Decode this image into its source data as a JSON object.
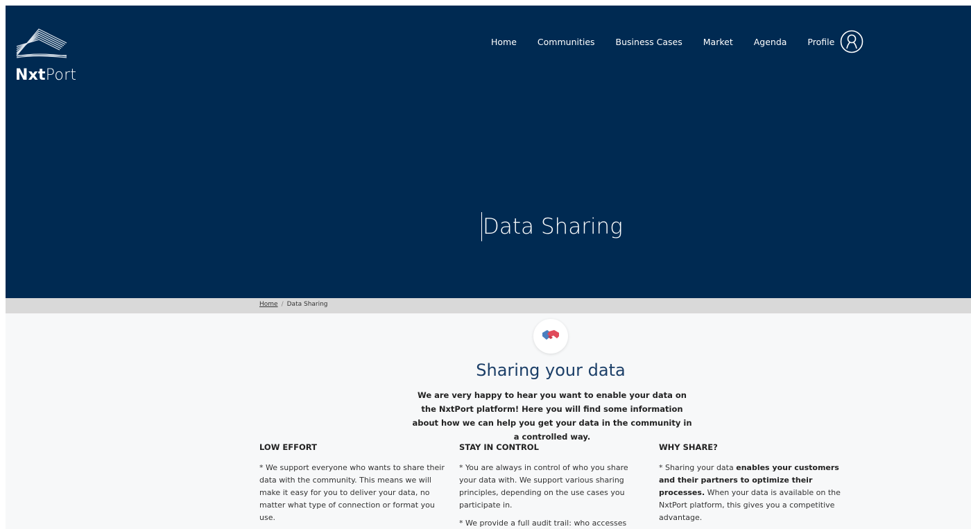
{
  "brand": {
    "logo_bold": "Nxt",
    "logo_light": "Port"
  },
  "nav": {
    "items": [
      "Home",
      "Communities",
      "Business Cases",
      "Market",
      "Agenda",
      "Profile"
    ],
    "profile_icon": "user-circle-icon"
  },
  "hero": {
    "title": "Data Sharing"
  },
  "breadcrumb": {
    "home": "Home",
    "separator": "/",
    "current": "Data Sharing"
  },
  "section": {
    "icon": "handshake-icon",
    "title": "Sharing your data",
    "intro": "We are very happy to hear you want to enable your data on the NxtPort platform! Here you will find some information about how we can help you get your data in the community in a controlled way."
  },
  "columns": {
    "low_effort": {
      "heading": "LOW EFFORT",
      "p1": "* We support everyone who wants to share their data with the community. This means we will make it easy for you to deliver your data, no matter what type of connection or format you use."
    },
    "stay_in_control": {
      "heading": "STAY IN CONTROL",
      "p1": "* You are always in control of who you share your data with. We support various sharing principles, depending on the use cases you participate in.",
      "p2": "* We provide a full audit trail: who accesses"
    },
    "why_share": {
      "heading": "WHY SHARE?",
      "p1_pre": "* Sharing your data ",
      "p1_bold": "enables your customers and their partners to optimize their processes.",
      "p1_post": " When your data is available on the NxtPort platform, this gives you a competitive advantage."
    }
  },
  "colors": {
    "hero_bg": "#002a52",
    "breadcrumb_bg": "#d9d9d9",
    "title_color": "#1c3f68",
    "page_bg": "#f7f8f9"
  }
}
